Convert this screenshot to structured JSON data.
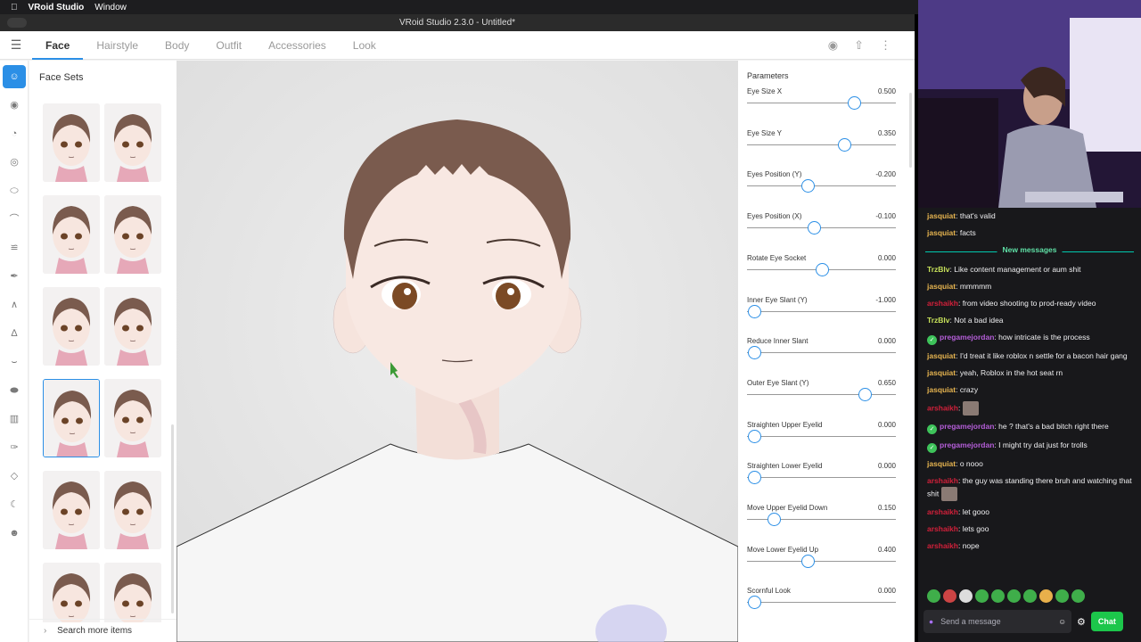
{
  "menubar": {
    "apple": "",
    "app": "VRoid Studio",
    "window": "Window"
  },
  "window": {
    "title": "VRoid Studio 2.3.0 - Untitled*"
  },
  "toolbar": {
    "tabs": [
      {
        "label": "Face"
      },
      {
        "label": "Hairstyle"
      },
      {
        "label": "Body"
      },
      {
        "label": "Outfit"
      },
      {
        "label": "Accessories"
      },
      {
        "label": "Look"
      }
    ],
    "icons": [
      "camera-icon",
      "share-icon",
      "more-vert-icon"
    ]
  },
  "face_sets": {
    "title": "Face Sets",
    "search_label": "Search more items"
  },
  "parameters": {
    "title": "Parameters",
    "items": [
      {
        "label": "Eye Size X",
        "value": "0.500",
        "level": 0.72
      },
      {
        "label": "Eye Size Y",
        "value": "0.350",
        "level": 0.65
      },
      {
        "label": "Eyes Position (Y)",
        "value": "-0.200",
        "level": 0.41
      },
      {
        "label": "Eyes Position (X)",
        "value": "-0.100",
        "level": 0.45
      },
      {
        "label": "Rotate Eye Socket",
        "value": "0.000",
        "level": 0.5
      },
      {
        "label": "Inner Eye Slant (Y)",
        "value": "-1.000",
        "level": 0.05
      },
      {
        "label": "Reduce Inner Slant",
        "value": "0.000",
        "level": 0.05
      },
      {
        "label": "Outer Eye Slant (Y)",
        "value": "0.650",
        "level": 0.79
      },
      {
        "label": "Straighten Upper Eyelid",
        "value": "0.000",
        "level": 0.05
      },
      {
        "label": "Straighten Lower Eyelid",
        "value": "0.000",
        "level": 0.05
      },
      {
        "label": "Move Upper Eyelid Down",
        "value": "0.150",
        "level": 0.18
      },
      {
        "label": "Move Lower Eyelid Up",
        "value": "0.400",
        "level": 0.41
      },
      {
        "label": "Scornful Look",
        "value": "0.000",
        "level": 0.05
      }
    ]
  },
  "chat": {
    "new_messages": "New messages",
    "messages": [
      {
        "user": "jasquiat",
        "color": "#e6b450",
        "text": ": that's valid"
      },
      {
        "user": "jasquiat",
        "color": "#e6b450",
        "text": ": facts"
      },
      {
        "user": "TrzBlv",
        "color": "#c6e05a",
        "text": ": Like content management or aum shit"
      },
      {
        "user": "jasquiat",
        "color": "#e6b450",
        "text": ": mmmmm"
      },
      {
        "user": "arshaikh",
        "color": "#d2203a",
        "text": ": from video shooting to prod-ready video"
      },
      {
        "user": "TrzBlv",
        "color": "#c6e05a",
        "text": ": Not a bad idea"
      },
      {
        "user": "pregamejordan",
        "color": "#b45ed8",
        "text": ": how intricate is the process",
        "badge": true
      },
      {
        "user": "jasquiat",
        "color": "#e6b450",
        "text": ": I'd treat it like roblox n settle for a bacon hair gang"
      },
      {
        "user": "jasquiat",
        "color": "#e6b450",
        "text": ": yeah, Roblox in the hot seat rn"
      },
      {
        "user": "jasquiat",
        "color": "#e6b450",
        "text": ": crazy"
      },
      {
        "user": "arshaikh",
        "color": "#d2203a",
        "text": ":",
        "emote": true
      },
      {
        "user": "pregamejordan",
        "color": "#b45ed8",
        "text": ": he ? that's a bad bitch right there",
        "badge": true
      },
      {
        "user": "pregamejordan",
        "color": "#b45ed8",
        "text": ": I might try dat just for trolls",
        "badge": true
      },
      {
        "user": "jasquiat",
        "color": "#e6b450",
        "text": ": o nooo"
      },
      {
        "user": "arshaikh",
        "color": "#d2203a",
        "text": ": the guy was standing there bruh and watching that shit",
        "emote": true
      },
      {
        "user": "arshaikh",
        "color": "#d2203a",
        "text": ": let gooo"
      },
      {
        "user": "arshaikh",
        "color": "#d2203a",
        "text": ": lets goo"
      },
      {
        "user": "arshaikh",
        "color": "#d2203a",
        "text": ": nope"
      }
    ],
    "input_placeholder": "Send a message",
    "chat_button": "Chat"
  }
}
